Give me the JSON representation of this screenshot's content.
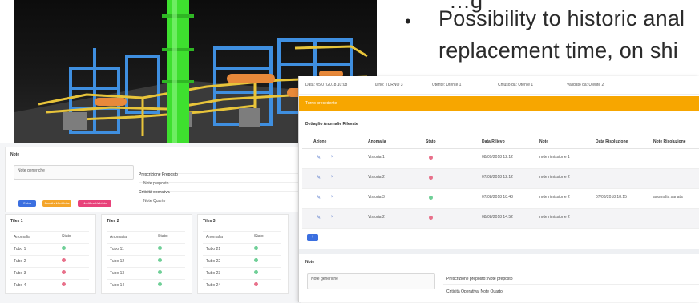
{
  "slide": {
    "bullet_dot": "•",
    "partial_top_line": "…g",
    "bullet_line_1": "Possibility to historic anal",
    "bullet_line_2": "replacement time, on shi"
  },
  "right_app": {
    "info_bar": [
      "Data: 05/07/2018 10:08",
      "Turno: TURNO 3",
      "Utente: Utente 1",
      "Chiuso da: Utente 1",
      "Validato da: Utente 2"
    ],
    "banner": "Turno precedente",
    "section_title": "Dettaglio Anomalie Rilevate",
    "columns": [
      "Azione",
      "Anomalia",
      "Stato",
      "Data Rilievo",
      "Note",
      "Data Risoluzione",
      "Note Risoluzione"
    ],
    "rows": [
      {
        "anomalia": "Vistoria 1",
        "stato": "#e8708a",
        "data_rilievo": "08/09/2018 12:12",
        "note": "note rimissione 1",
        "data_risoluzione": "",
        "note_risoluzione": ""
      },
      {
        "anomalia": "Vistoria 2",
        "stato": "#e8708a",
        "data_rilievo": "07/08/2018 12:12",
        "note": "note rimissione 2",
        "data_risoluzione": "",
        "note_risoluzione": ""
      },
      {
        "anomalia": "Vistoria 3",
        "stato": "#6fcf97",
        "data_rilievo": "07/08/2018 18:43",
        "note": "note rimissione 2",
        "data_risoluzione": "07/08/2018 18:15",
        "note_risoluzione": "anomalia sanata"
      },
      {
        "anomalia": "Vistoria 2",
        "stato": "#e8708a",
        "data_rilievo": "08/08/2018 14:52",
        "note": "note rimissione 2",
        "data_risoluzione": "",
        "note_risoluzione": ""
      }
    ],
    "add_label": "+",
    "note_title": "Note",
    "note_placeholder": "Note generiche",
    "fields": [
      "Prescrizione preposto: Note preposto",
      "Criticità Operativa: Note Quarto"
    ]
  },
  "left_app": {
    "note_title": "Note",
    "note_placeholder": "Note generiche",
    "fields": [
      "Prescrizione Preposto",
      "Note preposto",
      "Criticità operativa",
      "Note Quarto"
    ],
    "buttons": [
      "Salva",
      "Annulla Modifiche",
      "Modifica Validato"
    ],
    "tiles": [
      {
        "title": "Tiles 1",
        "col1": "Anomalia",
        "col2": "Stato",
        "rows": [
          [
            "Tubo 1",
            "#6fcf97"
          ],
          [
            "Tubo 2",
            "#e8708a"
          ],
          [
            "Tubo 3",
            "#e8708a"
          ],
          [
            "Tubo 4",
            "#e8708a"
          ]
        ]
      },
      {
        "title": "Tiles 2",
        "col1": "Anomalia",
        "col2": "Stato",
        "rows": [
          [
            "Tubo 11",
            "#6fcf97"
          ],
          [
            "Tubo 12",
            "#6fcf97"
          ],
          [
            "Tubo 13",
            "#6fcf97"
          ],
          [
            "Tubo 14",
            "#6fcf97"
          ]
        ]
      },
      {
        "title": "Tiles 3",
        "col1": "Anomalia",
        "col2": "Stato",
        "rows": [
          [
            "Tubo 21",
            "#6fcf97"
          ],
          [
            "Tubo 22",
            "#6fcf97"
          ],
          [
            "Tubo 23",
            "#6fcf97"
          ],
          [
            "Tubo 24",
            "#e8708a"
          ]
        ]
      }
    ]
  }
}
